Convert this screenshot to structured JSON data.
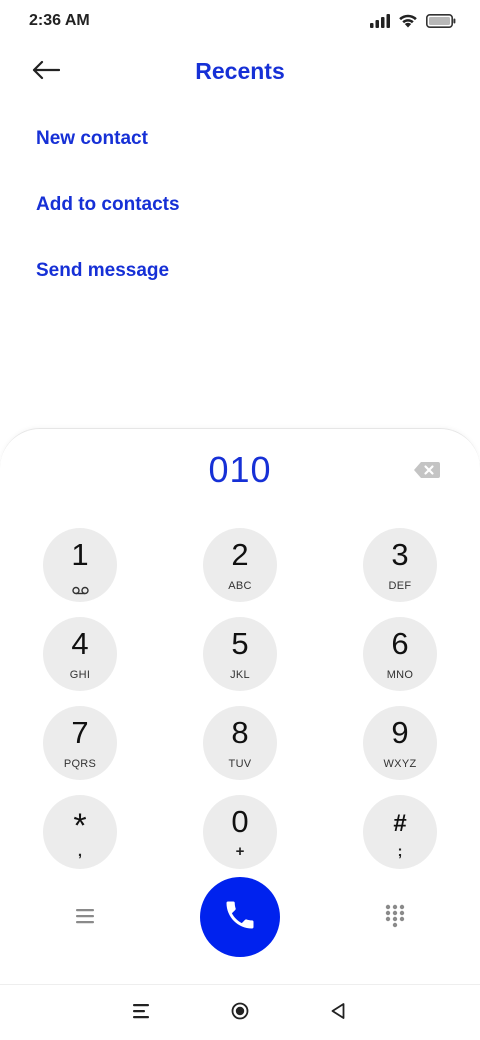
{
  "status_bar": {
    "time": "2:36 AM"
  },
  "header": {
    "title": "Recents"
  },
  "actions": [
    {
      "label": "New contact"
    },
    {
      "label": "Add to contacts"
    },
    {
      "label": "Send message"
    }
  ],
  "dialpad": {
    "number": "010",
    "keys": [
      {
        "digit": "1",
        "letters": ""
      },
      {
        "digit": "2",
        "letters": "ABC"
      },
      {
        "digit": "3",
        "letters": "DEF"
      },
      {
        "digit": "4",
        "letters": "GHI"
      },
      {
        "digit": "5",
        "letters": "JKL"
      },
      {
        "digit": "6",
        "letters": "MNO"
      },
      {
        "digit": "7",
        "letters": "PQRS"
      },
      {
        "digit": "8",
        "letters": "TUV"
      },
      {
        "digit": "9",
        "letters": "WXYZ"
      },
      {
        "digit": "*",
        "letters": ","
      },
      {
        "digit": "0",
        "letters": "+"
      },
      {
        "digit": "#",
        "letters": ";"
      }
    ],
    "icons": {
      "voicemail": "voicemail-icon",
      "menu": "menu-icon",
      "call": "phone-icon",
      "keypad": "dialpad-icon",
      "backspace": "backspace-icon"
    }
  },
  "colors": {
    "accent": "#1630d6",
    "call_button": "#0022ee",
    "key_background": "#ececec"
  }
}
